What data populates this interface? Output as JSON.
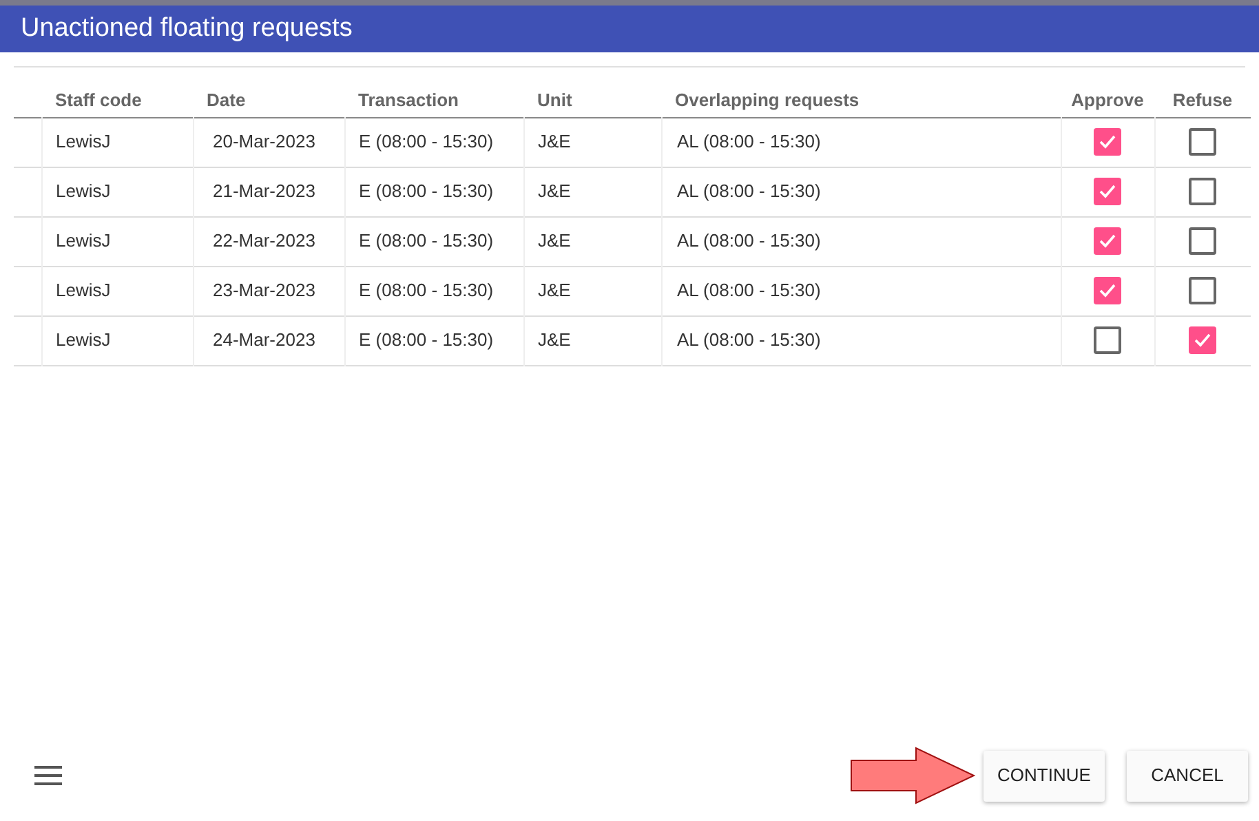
{
  "dialog": {
    "title": "Unactioned floating requests"
  },
  "table": {
    "columns": [
      "Staff code",
      "Date",
      "Transaction",
      "Unit",
      "Overlapping requests",
      "Approve",
      "Refuse"
    ],
    "rows": [
      {
        "staff_code": "LewisJ",
        "date": "20-Mar-2023",
        "transaction": "E (08:00 - 15:30)",
        "unit": "J&E",
        "overlapping": "AL (08:00 - 15:30)",
        "approve": true,
        "refuse": false
      },
      {
        "staff_code": "LewisJ",
        "date": "21-Mar-2023",
        "transaction": "E (08:00 - 15:30)",
        "unit": "J&E",
        "overlapping": "AL (08:00 - 15:30)",
        "approve": true,
        "refuse": false
      },
      {
        "staff_code": "LewisJ",
        "date": "22-Mar-2023",
        "transaction": "E (08:00 - 15:30)",
        "unit": "J&E",
        "overlapping": "AL (08:00 - 15:30)",
        "approve": true,
        "refuse": false
      },
      {
        "staff_code": "LewisJ",
        "date": "23-Mar-2023",
        "transaction": "E (08:00 - 15:30)",
        "unit": "J&E",
        "overlapping": "AL (08:00 - 15:30)",
        "approve": true,
        "refuse": false
      },
      {
        "staff_code": "LewisJ",
        "date": "24-Mar-2023",
        "transaction": "E (08:00 - 15:30)",
        "unit": "J&E",
        "overlapping": "AL (08:00 - 15:30)",
        "approve": false,
        "refuse": true
      }
    ]
  },
  "buttons": [
    "CONTINUE",
    "CANCEL"
  ]
}
